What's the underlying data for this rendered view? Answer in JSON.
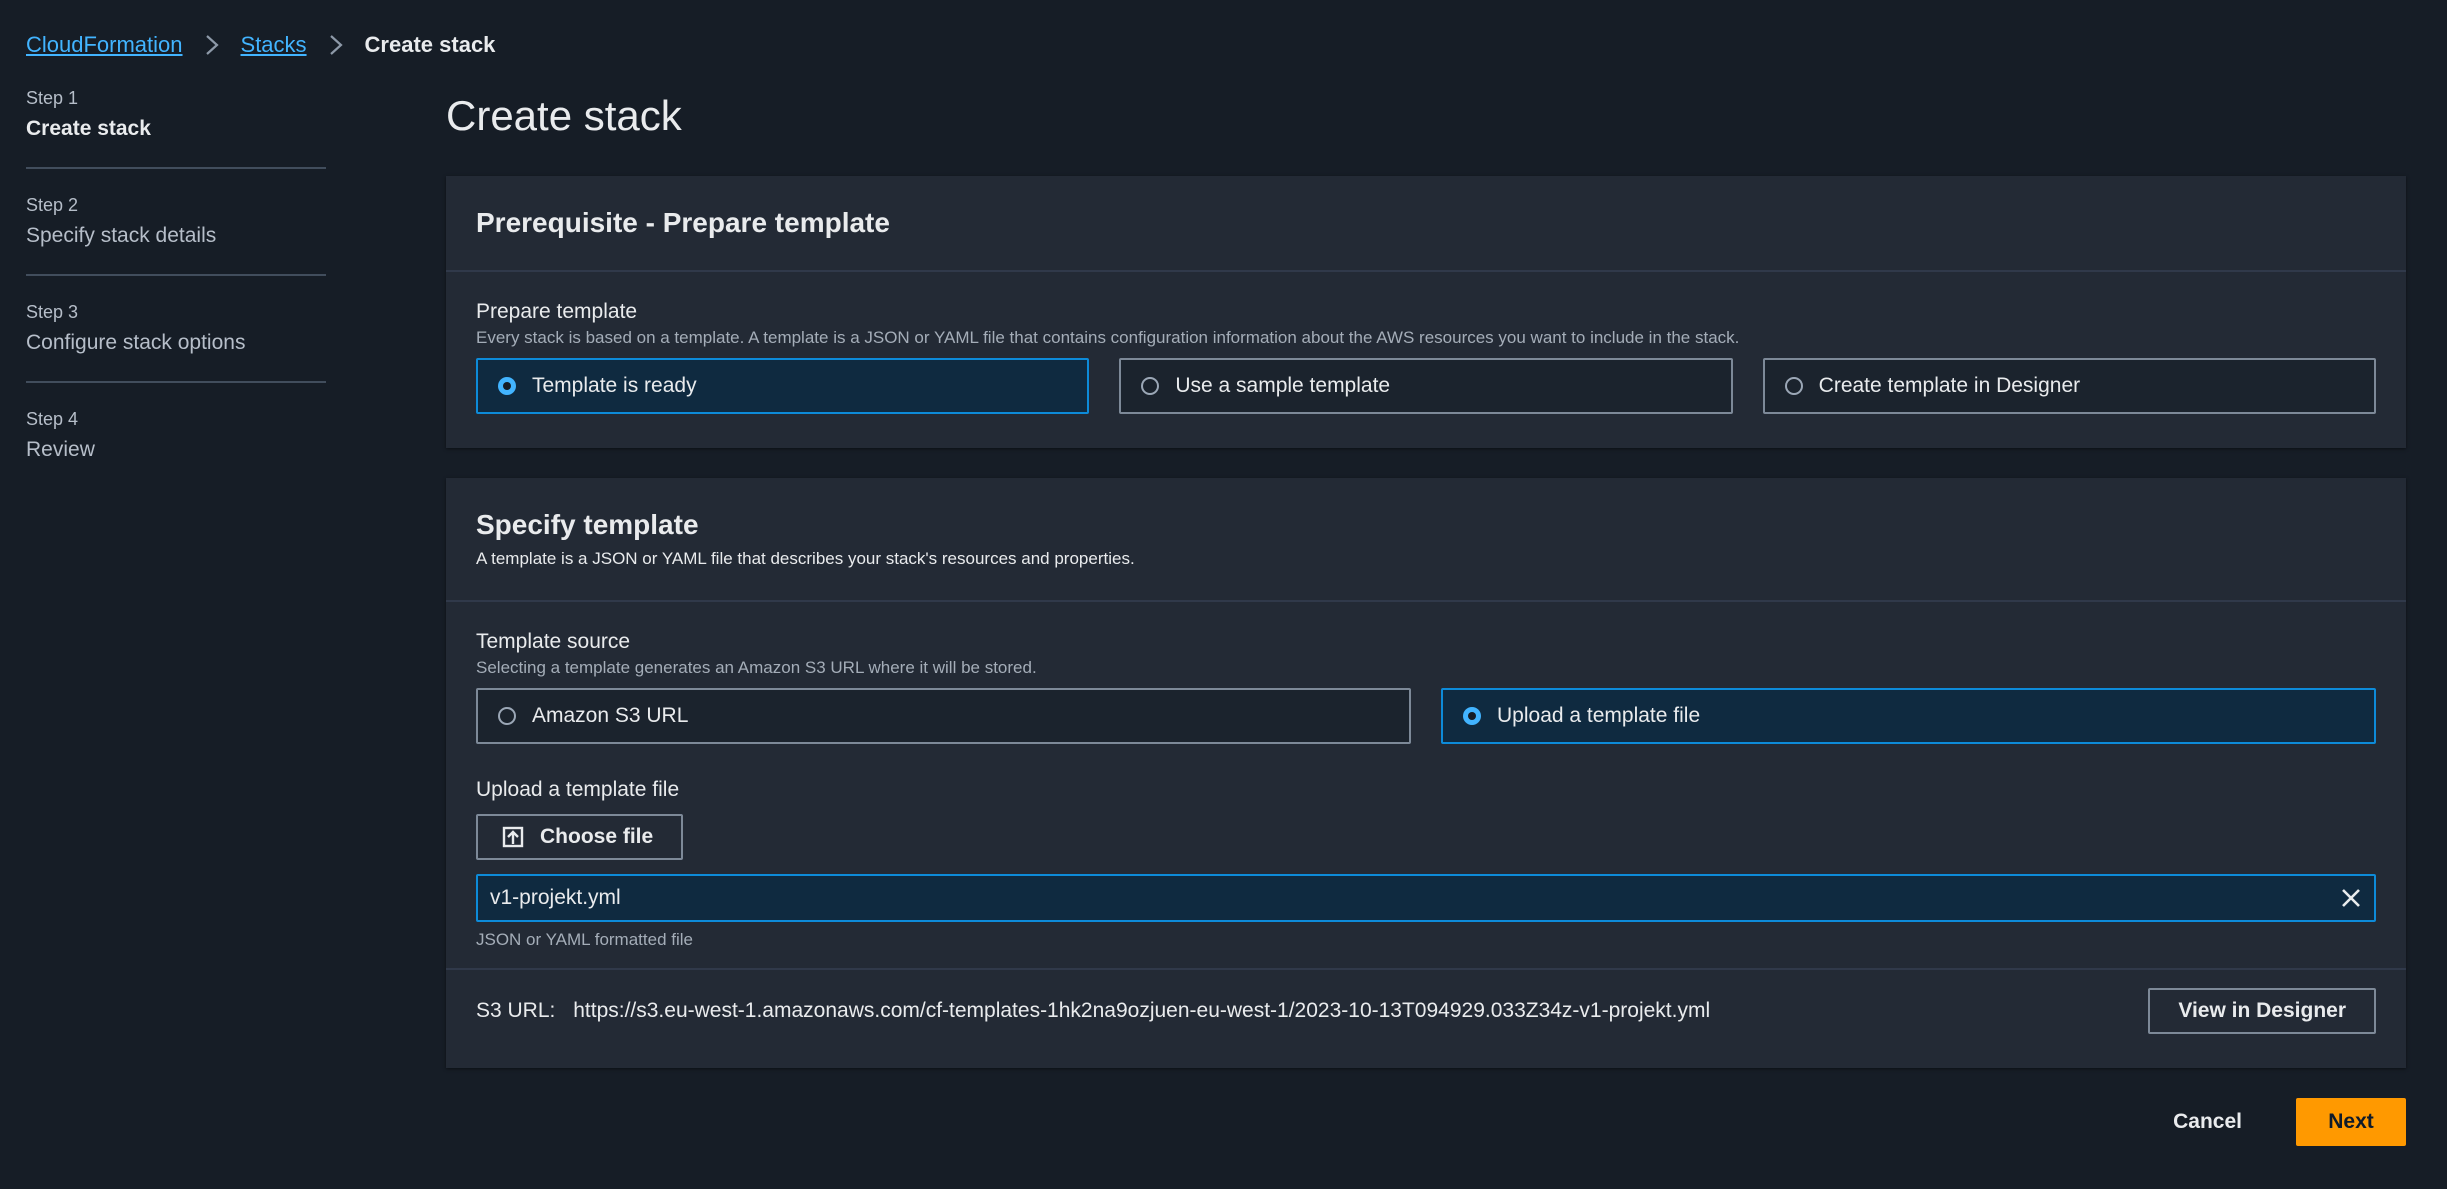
{
  "breadcrumb": {
    "items": [
      "CloudFormation",
      "Stacks"
    ],
    "current": "Create stack"
  },
  "steps": [
    {
      "num": "Step 1",
      "label": "Create stack"
    },
    {
      "num": "Step 2",
      "label": "Specify stack details"
    },
    {
      "num": "Step 3",
      "label": "Configure stack options"
    },
    {
      "num": "Step 4",
      "label": "Review"
    }
  ],
  "page_title": "Create stack",
  "prereq": {
    "heading": "Prerequisite - Prepare template",
    "label": "Prepare template",
    "description": "Every stack is based on a template. A template is a JSON or YAML file that contains configuration information about the AWS resources you want to include in the stack.",
    "options": [
      "Template is ready",
      "Use a sample template",
      "Create template in Designer"
    ],
    "selected": "Template is ready"
  },
  "specify": {
    "heading": "Specify template",
    "description": "A template is a JSON or YAML file that describes your stack's resources and properties.",
    "source_label": "Template source",
    "source_desc": "Selecting a template generates an Amazon S3 URL where it will be stored.",
    "source_options": [
      "Amazon S3 URL",
      "Upload a template file"
    ],
    "source_selected": "Upload a template file",
    "upload_label": "Upload a template file",
    "choose_file": "Choose file",
    "file_name": "v1-projekt.yml",
    "file_hint": "JSON or YAML formatted file",
    "s3_label": "S3 URL:",
    "s3_url": "https://s3.eu-west-1.amazonaws.com/cf-templates-1hk2na9ozjuen-eu-west-1/2023-10-13T094929.033Z34z-v1-projekt.yml",
    "view_designer": "View in Designer"
  },
  "actions": {
    "cancel": "Cancel",
    "next": "Next"
  },
  "colors": {
    "accent": "#42b4ff",
    "primary_button": "#ff9900",
    "background": "#161d26"
  }
}
